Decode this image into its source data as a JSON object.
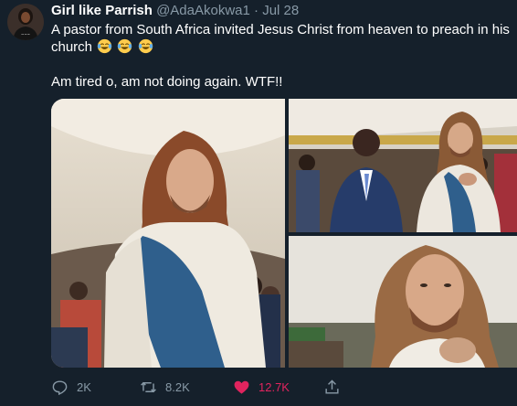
{
  "tweet": {
    "author_name": "Girl like Parrish",
    "handle": "@AdaAkokwa1",
    "separator": "·",
    "date": "Jul 28",
    "text_line1": "A pastor from South Africa invited Jesus Christ from heaven to preach in his",
    "text_line2": "church",
    "text_line3": "Am tired o, am not doing again. WTF!!",
    "emoji": "tears-of-joy-emoji ×3"
  },
  "actions": {
    "reply_count": "2K",
    "retweet_count": "8.2K",
    "like_count": "12.7K"
  },
  "colors": {
    "background": "#15202b",
    "secondary_text": "#8899a6",
    "like": "#e0245e"
  }
}
